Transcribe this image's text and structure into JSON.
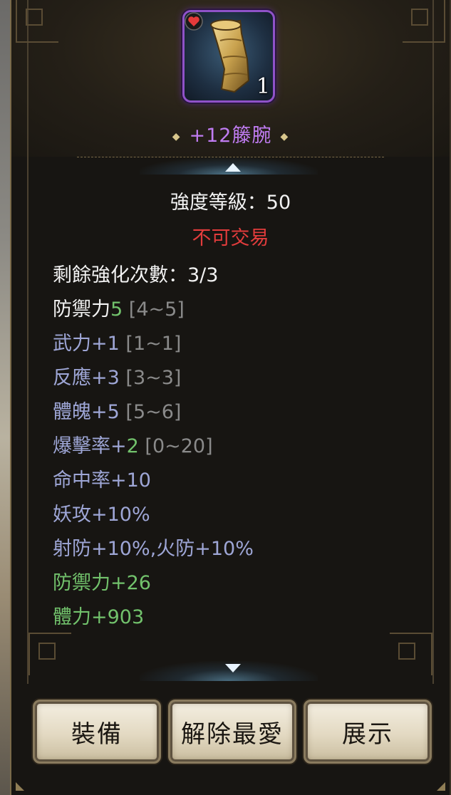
{
  "item": {
    "name": "+12籐腕",
    "quantity": "1",
    "icon": "gauntlet-icon",
    "badge_icon": "heart-icon",
    "name_color": "#c07cf2"
  },
  "enhance_level": "強度等級：50",
  "trade_status": "不可交易",
  "stats": {
    "remaining": "剩餘強化次數：3/3",
    "defense_label": "防禦力",
    "defense_value": "5",
    "defense_range": "[4~5]",
    "force_label": "武力+1",
    "force_range": "[1~1]",
    "reaction_label": "反應+3",
    "reaction_range": "[3~3]",
    "physique_label": "體魄+5",
    "physique_range": "[5~6]",
    "crit_label": "爆擊率+",
    "crit_value": "2",
    "crit_range": "[0~20]",
    "hit": "命中率+10",
    "demon_atk": "妖攻+10%",
    "resist": "射防+10%,火防+10%",
    "bonus_defense": "防禦力+26",
    "bonus_hp": "體力+903"
  },
  "buttons": {
    "equip": "裝備",
    "unfavorite": "解除最愛",
    "show": "展示"
  }
}
